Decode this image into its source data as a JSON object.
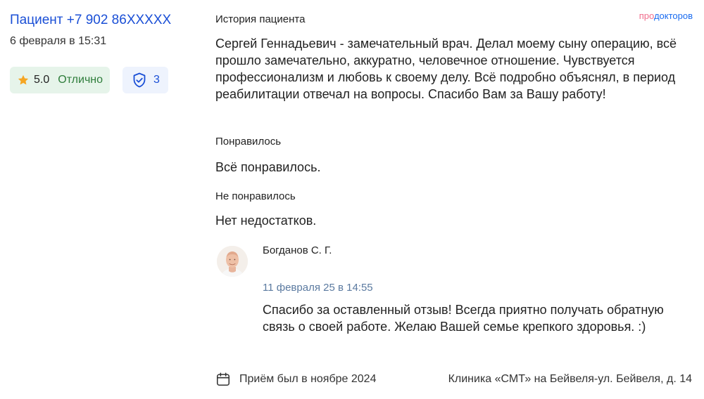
{
  "brand": {
    "part1": "про",
    "part2": "докторов"
  },
  "author": {
    "name": "Пациент +7 902 86XXXXX",
    "date": "6 февраля в 15:31"
  },
  "rating": {
    "value": "5.0",
    "label": "Отлично",
    "star_color": "#f5a623",
    "badge_bg": "#e6f4ea"
  },
  "verification": {
    "count": "3",
    "icon": "shield-check-icon"
  },
  "review": {
    "history_title": "История пациента",
    "history_text": "Сергей Геннадьевич - замечательный врач. Делал моему сыну операцию, всё прошло замечательно, аккуратно, человечное отношение. Чувствуется профессионализм и любовь к своему делу. Всё подробно объяснял, в период реабилитации отвечал на вопросы. Спасибо Вам за Вашу работу!",
    "liked_title": "Понравилось",
    "liked_text": "Всё понравилось.",
    "disliked_title": "Не понравилось",
    "disliked_text": "Нет недостатков."
  },
  "reply": {
    "doctor_name": "Богданов С. Г.",
    "date": "11 февраля 25 в 14:55",
    "text": "Спасибо за оставленный отзыв! Всегда приятно получать обратную связь о своей работе. Желаю Вашей семье крепкого здоровья. :)"
  },
  "footer": {
    "visit": "Приём был в ноябре 2024",
    "clinic": "Клиника «СМТ» на Бейвеля-ул. Бейвеля, д. 14",
    "icon": "calendar-icon"
  },
  "colors": {
    "link": "#1a4fd6",
    "reply_date": "#5b7aa0",
    "rating_text": "#2e7d3b"
  }
}
